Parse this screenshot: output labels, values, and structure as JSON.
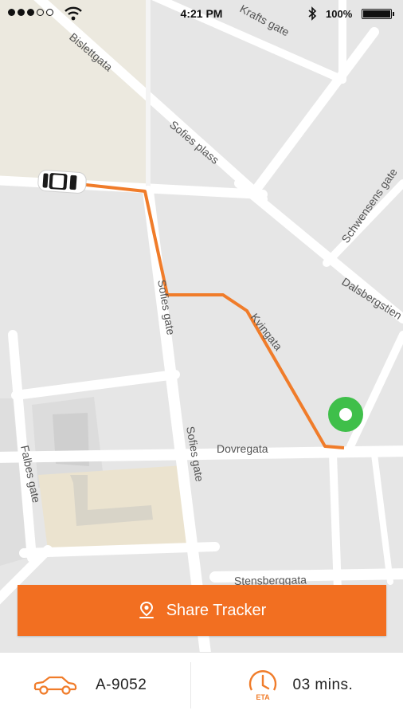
{
  "status_bar": {
    "time": "4:21 PM",
    "battery": "100%"
  },
  "map": {
    "streets": {
      "krafts_gate": "Krafts gate",
      "bislettgata": "Bislettgata",
      "sofies_plass": "Sofies plass",
      "schwensens_gate": "Schwensens gate",
      "dalsbergstien": "Dalsbergstien",
      "sofies_gate_upper": "Sofies gate",
      "sofies_gate_lower": "Sofies gate",
      "kvinegata": "Kvingata",
      "dovregata": "Dovregata",
      "falbes_gate": "Falbes gate",
      "stensberggata": "Stensberggata"
    },
    "colors": {
      "route": "#f07c2a",
      "destination": "#3fbf4a"
    }
  },
  "share_button": {
    "label": "Share Tracker",
    "icon": "location-pin-icon"
  },
  "trip": {
    "vehicle_icon": "car-icon",
    "vehicle_number": "A-9052",
    "eta_icon": "eta-clock-icon",
    "eta_icon_label": "ETA",
    "eta_value": "03 mins."
  }
}
